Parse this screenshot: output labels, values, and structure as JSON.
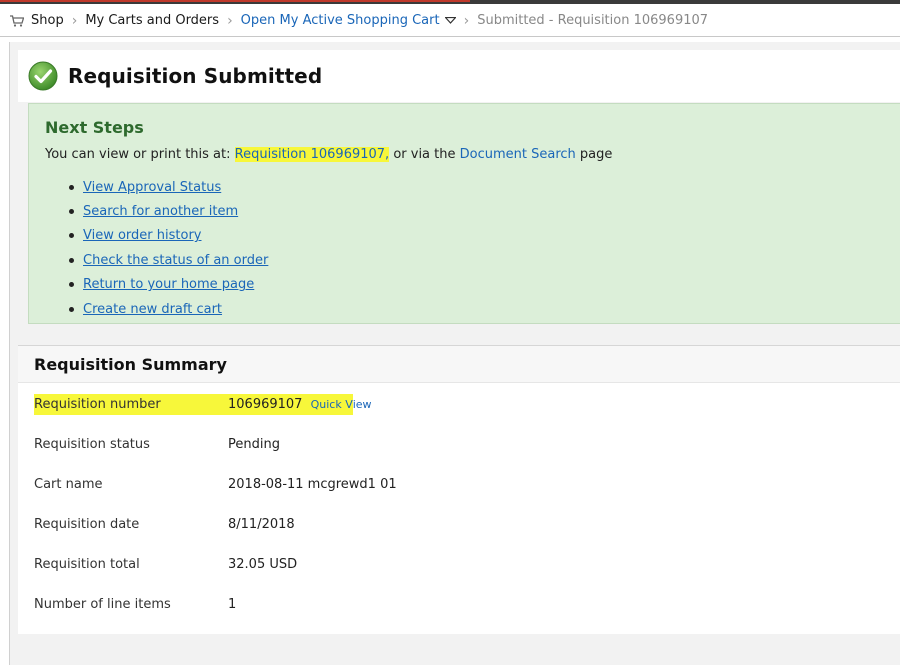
{
  "breadcrumb": {
    "shop": "Shop",
    "carts_orders": "My Carts and Orders",
    "active_cart": "Open My Active Shopping Cart",
    "current": "Submitted - Requisition 106969107"
  },
  "header": {
    "title": "Requisition Submitted"
  },
  "next_steps": {
    "title": "Next Steps",
    "line_prefix": "You can view or print this at: ",
    "req_link": "Requisition 106969107,",
    "line_mid": " or via the ",
    "doc_search": "Document Search",
    "line_suffix": " page",
    "links": [
      "View Approval Status",
      "Search for another item",
      "View order history",
      "Check the status of an order",
      "Return to your home page",
      "Create new draft cart"
    ]
  },
  "summary": {
    "title": "Requisition Summary",
    "rows": [
      {
        "label": "Requisition number",
        "value": "106969107"
      },
      {
        "label": "Requisition status",
        "value": "Pending"
      },
      {
        "label": "Cart name",
        "value": "2018-08-11 mcgrewd1 01"
      },
      {
        "label": "Requisition date",
        "value": "8/11/2018"
      },
      {
        "label": "Requisition total",
        "value": "32.05 USD"
      },
      {
        "label": "Number of line items",
        "value": "1"
      }
    ],
    "quick_view_a": "Quick V",
    "quick_view_b": "iew"
  },
  "colors": {
    "link": "#1a66b8",
    "highlight": "#f7f73a",
    "next_steps_bg": "#dcefd9",
    "next_steps_title": "#2e6a2e",
    "check_green": "#5aa83a"
  },
  "icons": {
    "cart": "cart-icon",
    "caret": "caret-down-icon",
    "check": "check-circle-icon"
  }
}
